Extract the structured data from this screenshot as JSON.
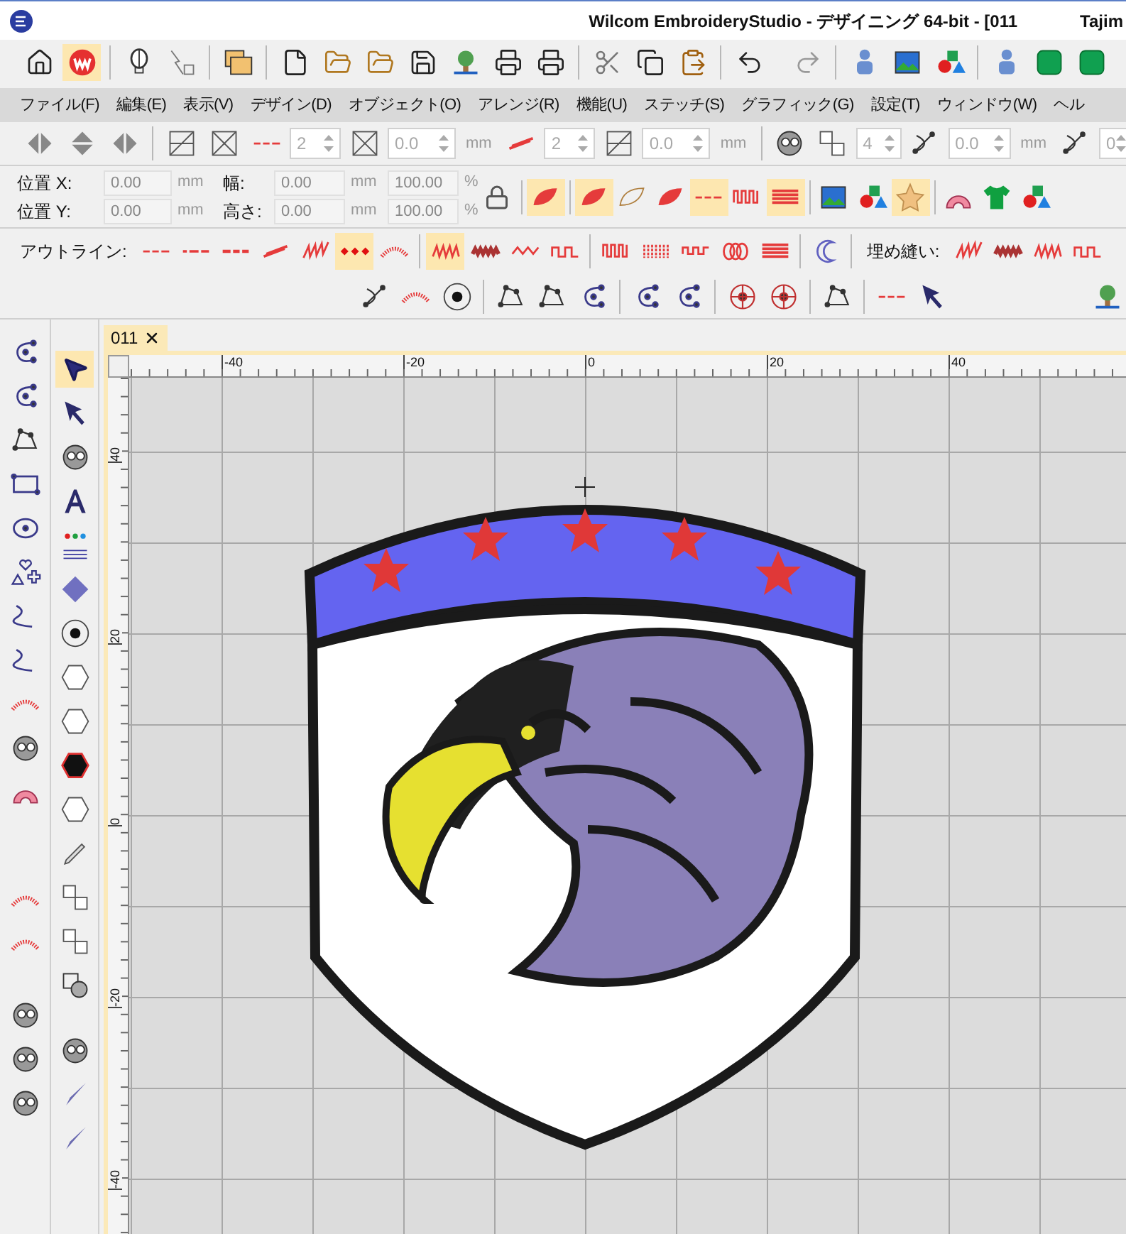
{
  "window": {
    "title": "Wilcom EmbroideryStudio - デザイニング 64-bit - [011",
    "title_cut": "Tajim"
  },
  "menu": [
    "ファイル(F)",
    "編集(E)",
    "表示(V)",
    "デザイン(D)",
    "オブジェクト(O)",
    "アレンジ(R)",
    "機能(U)",
    "ステッチ(S)",
    "グラフィック(G)",
    "設定(T)",
    "ウィンドウ(W)",
    "ヘル"
  ],
  "stitch_toolbar": {
    "fields": [
      {
        "value": "2",
        "disabled": true
      },
      {
        "value": "0.0",
        "unit": "mm",
        "disabled": true
      },
      {
        "value": "2",
        "disabled": true
      },
      {
        "value": "0.0",
        "unit": "mm",
        "disabled": true
      },
      {
        "value": "4",
        "disabled": true
      },
      {
        "value": "0.0",
        "unit": "mm",
        "disabled": true
      },
      {
        "value": "0",
        "disabled": true
      }
    ]
  },
  "position_toolbar": {
    "rows": [
      {
        "label": "位置 X:",
        "value": "0.00",
        "unit": "mm",
        "size_label": "幅:",
        "size_value": "0.00",
        "size_unit": "mm",
        "scale": "100.00",
        "scale_unit": "%"
      },
      {
        "label": "位置 Y:",
        "value": "0.00",
        "unit": "mm",
        "size_label": "高さ:",
        "size_value": "0.00",
        "size_unit": "mm",
        "scale": "100.00",
        "scale_unit": "%"
      }
    ]
  },
  "outline_toolbar": {
    "label": "アウトライン:",
    "styles": [
      {
        "selected": false
      },
      {
        "selected": false
      },
      {
        "selected": false
      },
      {
        "selected": false
      },
      {
        "selected": false
      },
      {
        "selected": true
      },
      {
        "selected": false
      },
      {
        "selected": true
      },
      {
        "selected": false
      },
      {
        "selected": false
      },
      {
        "selected": false
      },
      {
        "selected": false
      },
      {
        "selected": false
      },
      {
        "selected": false
      },
      {
        "selected": false
      },
      {
        "selected": false
      },
      {
        "selected": false
      }
    ]
  },
  "fill_toolbar": {
    "label": "埋め縫い:"
  },
  "tool_palette": {
    "select_tool": {
      "selected": true
    }
  },
  "document_tab": {
    "label": "011"
  },
  "rulers": {
    "horizontal": [
      "-40",
      "-20",
      "0",
      "20",
      "40"
    ],
    "vertical": [
      "40",
      "20",
      "0",
      "-20",
      "-40"
    ]
  }
}
